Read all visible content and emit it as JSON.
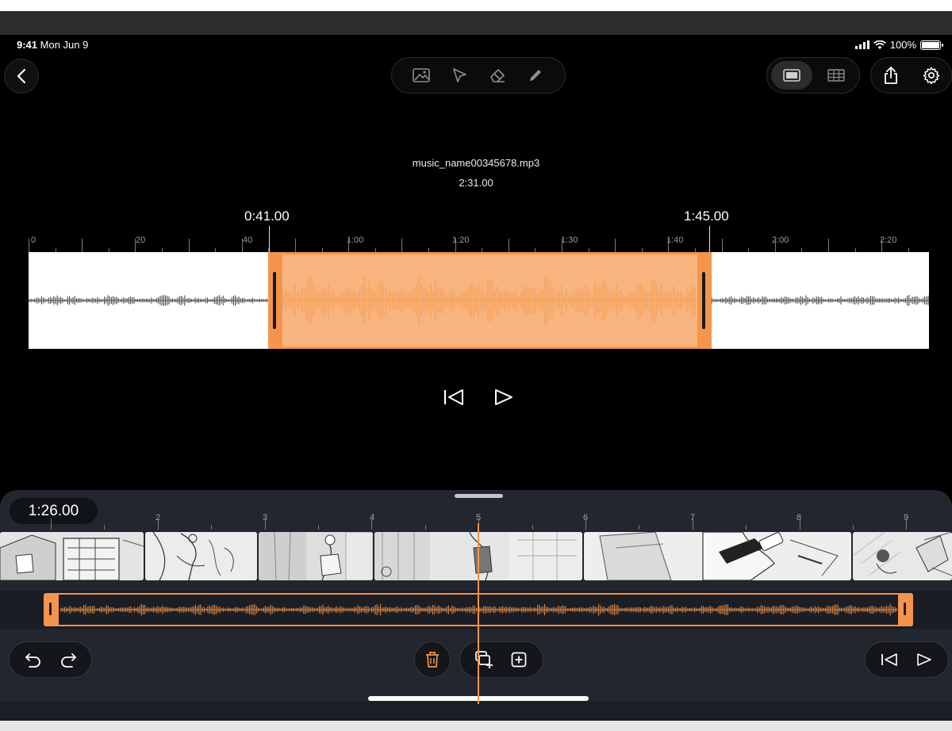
{
  "status_bar": {
    "time": "9:41",
    "date": "Mon Jun 9",
    "battery": "100%"
  },
  "toolbar": {
    "back_icon": "chevron-left-icon",
    "tools": [
      "image-icon",
      "pointer-icon",
      "eraser-icon",
      "pencil-icon"
    ],
    "view_modes": [
      "single-frame-icon",
      "grid-icon"
    ],
    "share_icon": "share-icon",
    "settings_icon": "gear-icon"
  },
  "audio": {
    "file_name": "music_name00345678.mp3",
    "duration": "2:31.00",
    "selection_start": "0:41.00",
    "selection_end": "1:45.00",
    "ruler_labels": [
      "0",
      "20",
      "40",
      "1:00",
      "1:20",
      "1:30",
      "1:40",
      "2:00",
      "2:20"
    ]
  },
  "playback": {
    "rewind_icon": "skip-to-start-icon",
    "play_icon": "play-icon"
  },
  "timeline": {
    "timecode": "1:26.00",
    "frame_numbers": [
      "2",
      "3",
      "4",
      "5",
      "6",
      "7",
      "8",
      "9"
    ],
    "accent_color": "#f5944b"
  },
  "bottom_controls": {
    "undo_icon": "undo-icon",
    "redo_icon": "redo-icon",
    "delete_icon": "trash-icon",
    "duplicate_icon": "duplicate-frame-icon",
    "add_icon": "add-frame-icon",
    "rewind_icon": "skip-to-start-icon",
    "play_icon": "play-icon"
  }
}
